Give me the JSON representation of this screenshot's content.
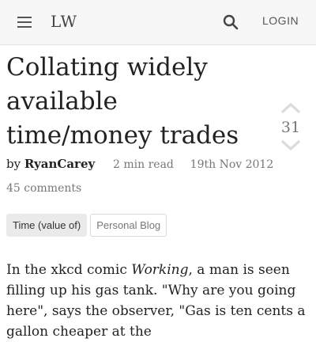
{
  "appbar": {
    "menu_icon": "menu-icon",
    "logo": "LW",
    "search_icon": "search-icon",
    "login_label": "LOGIN"
  },
  "post": {
    "title": "Collating widely available time/money trades",
    "score": "31",
    "upvote_icon": "chevron-up-icon",
    "downvote_icon": "chevron-down-icon",
    "by_label": "by",
    "author": "RyanCarey",
    "read_time": "2 min read",
    "date": "19th Nov 2012",
    "comments": "45 comments",
    "tags": [
      {
        "label": "Time (value of)",
        "style": "core"
      },
      {
        "label": "Personal Blog",
        "style": "plain"
      }
    ],
    "body_part1": "In the xkcd comic ",
    "body_italic": "Working",
    "body_part2": ", a man is seen filling up his gas tank. \"Why are you going here\", says the observer, \"Gas is ten cents a gallon cheaper at the"
  },
  "colors": {
    "appbar_bg": "#f7f7f7",
    "vote_icon": "#dcdcdc",
    "text": "#222222",
    "muted": "#777777"
  }
}
